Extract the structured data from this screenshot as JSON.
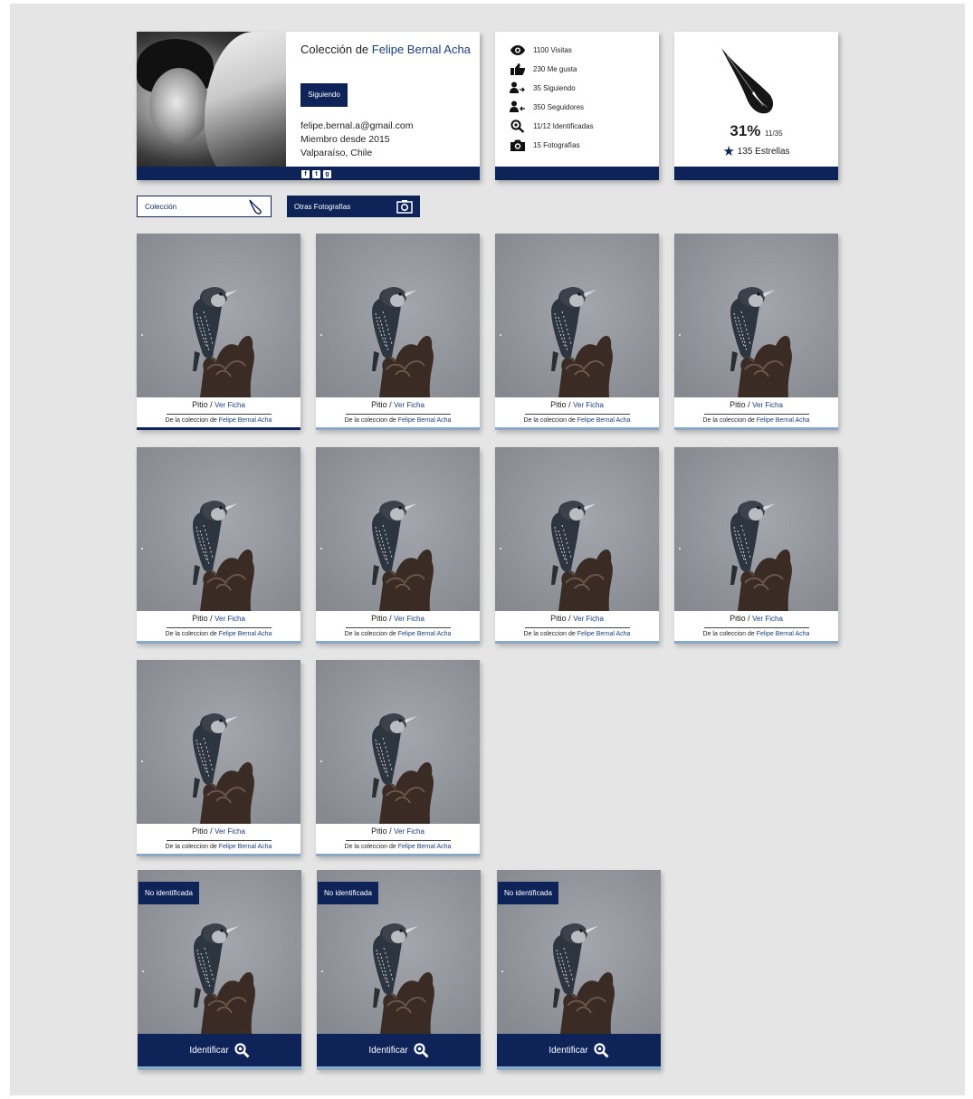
{
  "profile": {
    "title_prefix": "Colección de",
    "name": "Felipe Bernal Acha",
    "follow_label": "Siguiendo",
    "email": "felipe.bernal.a@gmail.com",
    "member_since": "Miembro desde 2015",
    "location": "Valparaíso, Chile",
    "socials": [
      "f",
      "t",
      "g"
    ]
  },
  "stats": [
    {
      "icon": "eye-icon",
      "label": "1100 Visitas"
    },
    {
      "icon": "thumbs-up-icon",
      "label": "230 Me gusta"
    },
    {
      "icon": "following-icon",
      "label": "35 Siguiendo"
    },
    {
      "icon": "followers-icon",
      "label": "350 Seguidores"
    },
    {
      "icon": "zoom-icon",
      "label": "11/12 Identificadas"
    },
    {
      "icon": "camera-icon",
      "label": "15 Fotografías"
    }
  ],
  "score": {
    "percent": "31%",
    "fraction": "11/35",
    "stars": "135 Estrellas"
  },
  "tabs": {
    "coleccion": "Colección",
    "otras": "Otras Fotografías"
  },
  "photos": [
    {
      "species": "Pitio",
      "sep": " / ",
      "link": "Ver Ficha",
      "from": "De la coleccion de ",
      "owner": "Felipe Bernal Acha",
      "active": true
    },
    {
      "species": "Pitio",
      "sep": " / ",
      "link": "Ver Ficha",
      "from": "De la coleccion de ",
      "owner": "Felipe Bernal Acha",
      "active": false
    },
    {
      "species": "Pitio",
      "sep": " / ",
      "link": "Ver Ficha",
      "from": "De la coleccion de ",
      "owner": "Felipe Bernal Acha",
      "active": false
    },
    {
      "species": "Pitio",
      "sep": " / ",
      "link": "Ver Ficha",
      "from": "De la coleccion de ",
      "owner": "Felipe Bernal Acha",
      "active": false
    },
    {
      "species": "Pitio",
      "sep": " / ",
      "link": "Ver Ficha",
      "from": "De la coleccion de ",
      "owner": "Felipe Bernal Acha",
      "active": false
    },
    {
      "species": "Pitio",
      "sep": " / ",
      "link": "Ver Ficha",
      "from": "De la coleccion de ",
      "owner": "Felipe Bernal Acha",
      "active": false
    },
    {
      "species": "Pitio",
      "sep": " / ",
      "link": "Ver Ficha",
      "from": "De la coleccion de ",
      "owner": "Felipe Bernal Acha",
      "active": false
    },
    {
      "species": "Pitio",
      "sep": " / ",
      "link": "Ver Ficha",
      "from": "De la coleccion de ",
      "owner": "Felipe Bernal Acha",
      "active": false
    },
    {
      "species": "Pitio",
      "sep": " / ",
      "link": "Ver Ficha",
      "from": "De la coleccion de ",
      "owner": "Felipe Bernal Acha",
      "active": false
    },
    {
      "species": "Pitio",
      "sep": " / ",
      "link": "Ver Ficha",
      "from": "De la coleccion de ",
      "owner": "Felipe Bernal Acha",
      "active": false
    }
  ],
  "unidentified": [
    {
      "badge": "No identificada",
      "action": "Identificar"
    },
    {
      "badge": "No identificada",
      "action": "Identificar"
    },
    {
      "badge": "No identificada",
      "action": "Identificar"
    }
  ],
  "colors": {
    "primary": "#0e2459",
    "link": "#1a3e7a",
    "background": "#e5e5e5",
    "accent_bar": "#8aa9c9"
  }
}
